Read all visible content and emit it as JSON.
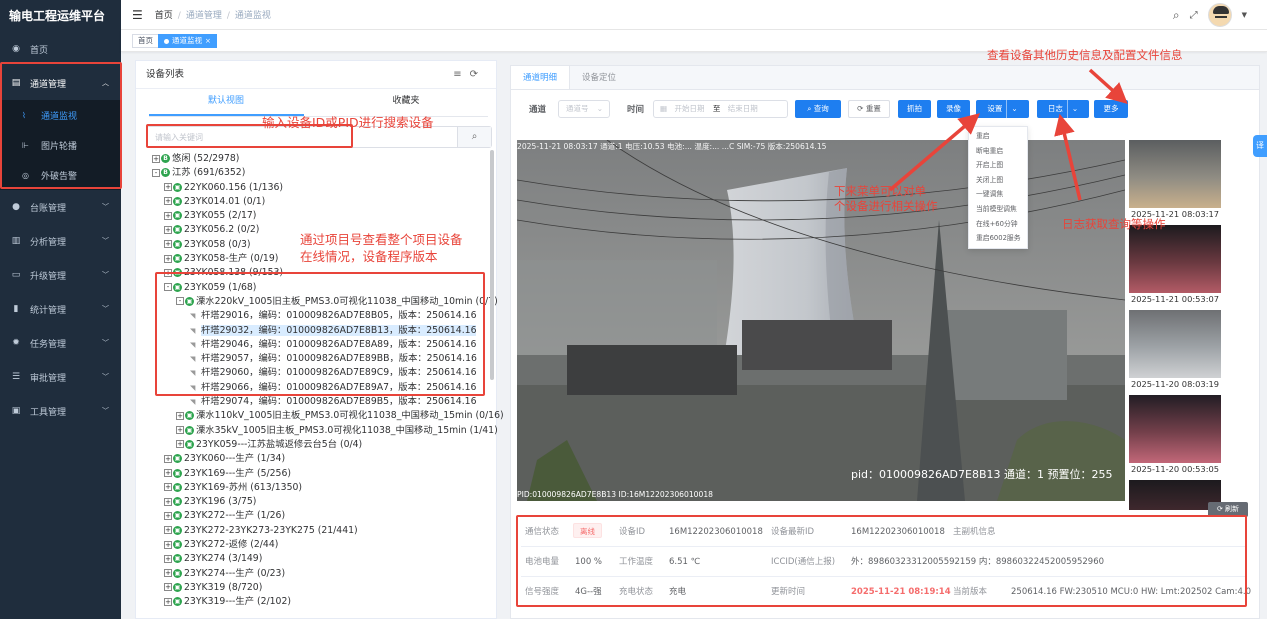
{
  "app": {
    "title": "输电工程运维平台"
  },
  "sidebar": {
    "items": [
      {
        "icon": "dashboard-icon",
        "glyph": "◉",
        "label": "首页"
      },
      {
        "icon": "document-icon",
        "glyph": "▤",
        "label": "通道管理",
        "open": true,
        "children": [
          {
            "icon": "monitor-icon",
            "glyph": "⌇",
            "label": "通道监视",
            "active": true
          },
          {
            "icon": "image-icon",
            "glyph": "⊩",
            "label": "图片轮播"
          },
          {
            "icon": "eye-icon",
            "glyph": "◎",
            "label": "外破告警"
          }
        ]
      },
      {
        "icon": "github-icon",
        "glyph": "●",
        "label": "台账管理"
      },
      {
        "icon": "chart-icon",
        "glyph": "▥",
        "label": "分析管理"
      },
      {
        "icon": "upgrade-icon",
        "glyph": "▭",
        "label": "升级管理"
      },
      {
        "icon": "bar-chart-icon",
        "glyph": "▮",
        "label": "统计管理"
      },
      {
        "icon": "gear-icon",
        "glyph": "✹",
        "label": "任务管理"
      },
      {
        "icon": "audit-icon",
        "glyph": "☰",
        "label": "审批管理"
      },
      {
        "icon": "tools-icon",
        "glyph": "▣",
        "label": "工具管理"
      }
    ]
  },
  "header": {
    "breadcrumb": [
      "首页",
      "通道管理",
      "通道监视"
    ],
    "icons": [
      "search-icon",
      "fullscreen-icon",
      "avatar"
    ]
  },
  "tags": [
    {
      "label": "首页",
      "active": false
    },
    {
      "label": "通道监视",
      "active": true
    }
  ],
  "device_panel": {
    "title": "设备列表",
    "tabs": [
      "默认视图",
      "收藏夹"
    ],
    "search_placeholder": "请输入关键词",
    "tree": [
      {
        "depth": 0,
        "toggle": "+",
        "type": "org",
        "text": "悠闲 (52/2978)"
      },
      {
        "depth": 0,
        "toggle": "-",
        "type": "org",
        "text": "江苏 (691/6352)"
      },
      {
        "depth": 1,
        "toggle": "+",
        "type": "proj",
        "text": "22YK060.156 (1/136)"
      },
      {
        "depth": 1,
        "toggle": "+",
        "type": "proj",
        "text": "23YK014.01 (0/1)"
      },
      {
        "depth": 1,
        "toggle": "+",
        "type": "proj",
        "text": "23YK055 (2/17)"
      },
      {
        "depth": 1,
        "toggle": "+",
        "type": "proj",
        "text": "23YK056.2 (0/2)"
      },
      {
        "depth": 1,
        "toggle": "+",
        "type": "proj",
        "text": "23YK058 (0/3)"
      },
      {
        "depth": 1,
        "toggle": "+",
        "type": "proj",
        "text": "23YK058-生产 (0/19)"
      },
      {
        "depth": 1,
        "toggle": "+",
        "type": "proj",
        "text": "23YK058.138 (9/153)"
      },
      {
        "depth": 1,
        "toggle": "-",
        "type": "proj",
        "text": "23YK059 (1/68)"
      },
      {
        "depth": 2,
        "toggle": "-",
        "type": "line",
        "text": "溧水220kV_1005旧主板_PMS3.0可视化11038_中国移动_10min (0/7)"
      },
      {
        "depth": 3,
        "toggle": "",
        "type": "leaf",
        "text": "杆塔29016，编码：010009826AD7E8B05，版本：250614.16"
      },
      {
        "depth": 3,
        "toggle": "",
        "type": "leaf",
        "text": "杆塔29032，编码：010009826AD7E8B13，版本：250614.16",
        "selected": true
      },
      {
        "depth": 3,
        "toggle": "",
        "type": "leaf",
        "text": "杆塔29046，编码：010009826AD7E8A89，版本：250614.16"
      },
      {
        "depth": 3,
        "toggle": "",
        "type": "leaf",
        "text": "杆塔29057，编码：010009826AD7E89BB，版本：250614.16"
      },
      {
        "depth": 3,
        "toggle": "",
        "type": "leaf",
        "text": "杆塔29060，编码：010009826AD7E89C9，版本：250614.16"
      },
      {
        "depth": 3,
        "toggle": "",
        "type": "leaf",
        "text": "杆塔29066，编码：010009826AD7E89A7，版本：250614.16"
      },
      {
        "depth": 3,
        "toggle": "",
        "type": "leaf",
        "text": "杆塔29074，编码：010009826AD7E89B5，版本：250614.16"
      },
      {
        "depth": 2,
        "toggle": "+",
        "type": "line",
        "text": "溧水110kV_1005旧主板_PMS3.0可视化11038_中国移动_15min (0/16)"
      },
      {
        "depth": 2,
        "toggle": "+",
        "type": "line",
        "text": "溧水35kV_1005旧主板_PMS3.0可视化11038_中国移动_15min (1/41)"
      },
      {
        "depth": 2,
        "toggle": "+",
        "type": "line",
        "text": "23YK059---江苏盐城返修云台5台 (0/4)"
      },
      {
        "depth": 1,
        "toggle": "+",
        "type": "proj",
        "text": "23YK060---生产 (1/34)"
      },
      {
        "depth": 1,
        "toggle": "+",
        "type": "proj",
        "text": "23YK169---生产 (5/256)"
      },
      {
        "depth": 1,
        "toggle": "+",
        "type": "proj",
        "text": "23YK169-苏州 (613/1350)"
      },
      {
        "depth": 1,
        "toggle": "+",
        "type": "proj",
        "text": "23YK196 (3/75)"
      },
      {
        "depth": 1,
        "toggle": "+",
        "type": "proj",
        "text": "23YK272---生产 (1/26)"
      },
      {
        "depth": 1,
        "toggle": "+",
        "type": "proj",
        "text": "23YK272-23YK273-23YK275 (21/441)"
      },
      {
        "depth": 1,
        "toggle": "+",
        "type": "proj",
        "text": "23YK272-返修 (2/44)"
      },
      {
        "depth": 1,
        "toggle": "+",
        "type": "proj",
        "text": "23YK274 (3/149)"
      },
      {
        "depth": 1,
        "toggle": "+",
        "type": "proj",
        "text": "23YK274---生产 (0/23)"
      },
      {
        "depth": 1,
        "toggle": "+",
        "type": "proj",
        "text": "23YK319 (8/720)"
      },
      {
        "depth": 1,
        "toggle": "+",
        "type": "proj",
        "text": "23YK319---生产 (2/102)"
      }
    ]
  },
  "channel": {
    "tabs": [
      "通道明细",
      "设备定位"
    ],
    "toolbar": {
      "channel_label": "通道",
      "channel_placeholder": "通道号",
      "time_label": "时间",
      "start_placeholder": "开始日期",
      "to": "至",
      "end_placeholder": "结束日期",
      "query": "查询",
      "reset": "重置",
      "capture": "抓拍",
      "record": "录像",
      "settings": "设置",
      "log": "日志",
      "more": "更多"
    },
    "settings_menu": [
      "重启",
      "断电重启",
      "开启上图",
      "关闭上图",
      "一键调焦",
      "当前模型调焦",
      "在线+60分钟",
      "重启6002服务"
    ],
    "video": {
      "overlay_top": "2025-11-21 08:03:17 通道:1 电压:10.53 电池:... 温度:... ...C SIM:-75 版本:250614.15",
      "overlay_pid": "pid：010009826AD7E8B13 通道：1 预置位：255",
      "overlay_bottom": "PID:010009826AD7E8B13 ID:16M12202306010018"
    },
    "thumbnails": [
      "2025-11-21 08:03:17",
      "2025-11-21 00:53:07",
      "2025-11-20 08:03:19",
      "2025-11-20 00:53:05"
    ],
    "refresh": "刷新"
  },
  "info": {
    "comm_status_label": "通信状态",
    "comm_status": "离线",
    "device_id_label": "设备ID",
    "device_id": "16M12202306010018",
    "latest_id_label": "设备最新ID",
    "latest_id": "16M12202306010018",
    "board_info_label": "主副机信息",
    "battery_label": "电池电量",
    "battery": "100 %",
    "temp_label": "工作温度",
    "temp": "6.51 ℃",
    "iccid_label": "ICCID(通信上报)",
    "iccid": "外：89860323312005592159  内：89860322452005952960",
    "signal_label": "信号强度",
    "signal": "4G--强",
    "charge_label": "充电状态",
    "charge": "充电",
    "update_label": "更新时间",
    "update": "2025-11-21 08:19:14",
    "version_label": "当前版本",
    "version": "250614.16 FW:230510 MCU:0 HW: Lmt:202502 Cam:4.0"
  },
  "translate_tab": "译",
  "annotations": {
    "search": "输入设备ID或PID进行搜索设备",
    "project": "通过项目号查看整个项目设备\n在线情况，设备程序版本",
    "dropdown": "下来菜单可以对单\n个设备进行相关操作",
    "more": "查看设备其他历史信息及配置文件信息",
    "log": "日志获取查询等操作"
  },
  "colors": {
    "sidebar": "#1f2d3d",
    "accent": "#409eff",
    "annotation": "#e8443a"
  }
}
